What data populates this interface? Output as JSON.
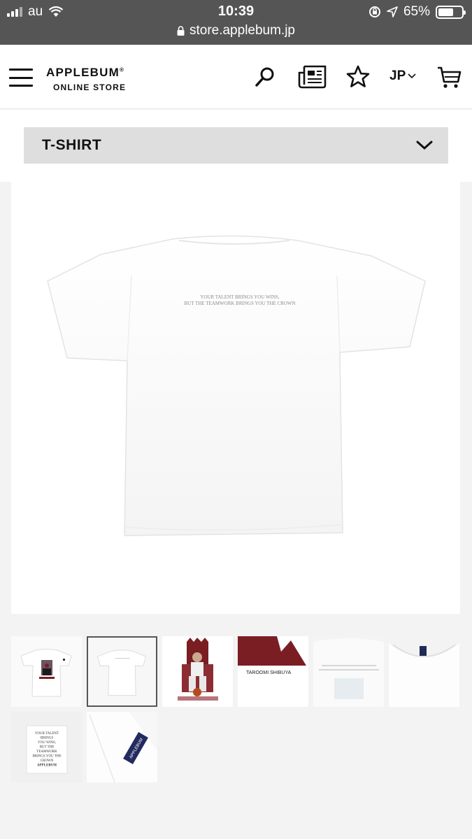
{
  "status_bar": {
    "carrier": "au",
    "time": "10:39",
    "battery_percent": "65%",
    "battery_level": 0.65,
    "url": "store.applebum.jp"
  },
  "header": {
    "brand": "APPLEBUM",
    "brand_mark": "®",
    "subtitle": "ONLINE STORE",
    "language": "JP",
    "icons": [
      "menu-icon",
      "search-icon",
      "news-icon",
      "star-icon",
      "chevron-down-icon",
      "cart-icon"
    ]
  },
  "category": {
    "selected": "T-SHIRT"
  },
  "product": {
    "print_text_line1": "YOUR TALENT BRINGS YOU WINS,",
    "print_text_line2": "BUT THE TEAMWORK BRINGS YOU THE CROWN",
    "thumbnail_tagline": "TAROOMI SHIBUYA",
    "label_text": [
      "YOUR TALENT",
      "BRINGS",
      "YOU WINS,",
      "BUT THE",
      "TEAMWORK",
      "BRINGS YOU THE",
      "CROWN"
    ],
    "label_brand": "APPLEBUM",
    "sleeve_tag": "APPLEBUM",
    "thumbnail_count": 8,
    "selected_thumbnail": 2
  },
  "colors": {
    "status_bar_bg": "#555555",
    "category_bg": "#dedede",
    "page_bg": "#f3f3f3",
    "print_red": "#7a1e24"
  }
}
